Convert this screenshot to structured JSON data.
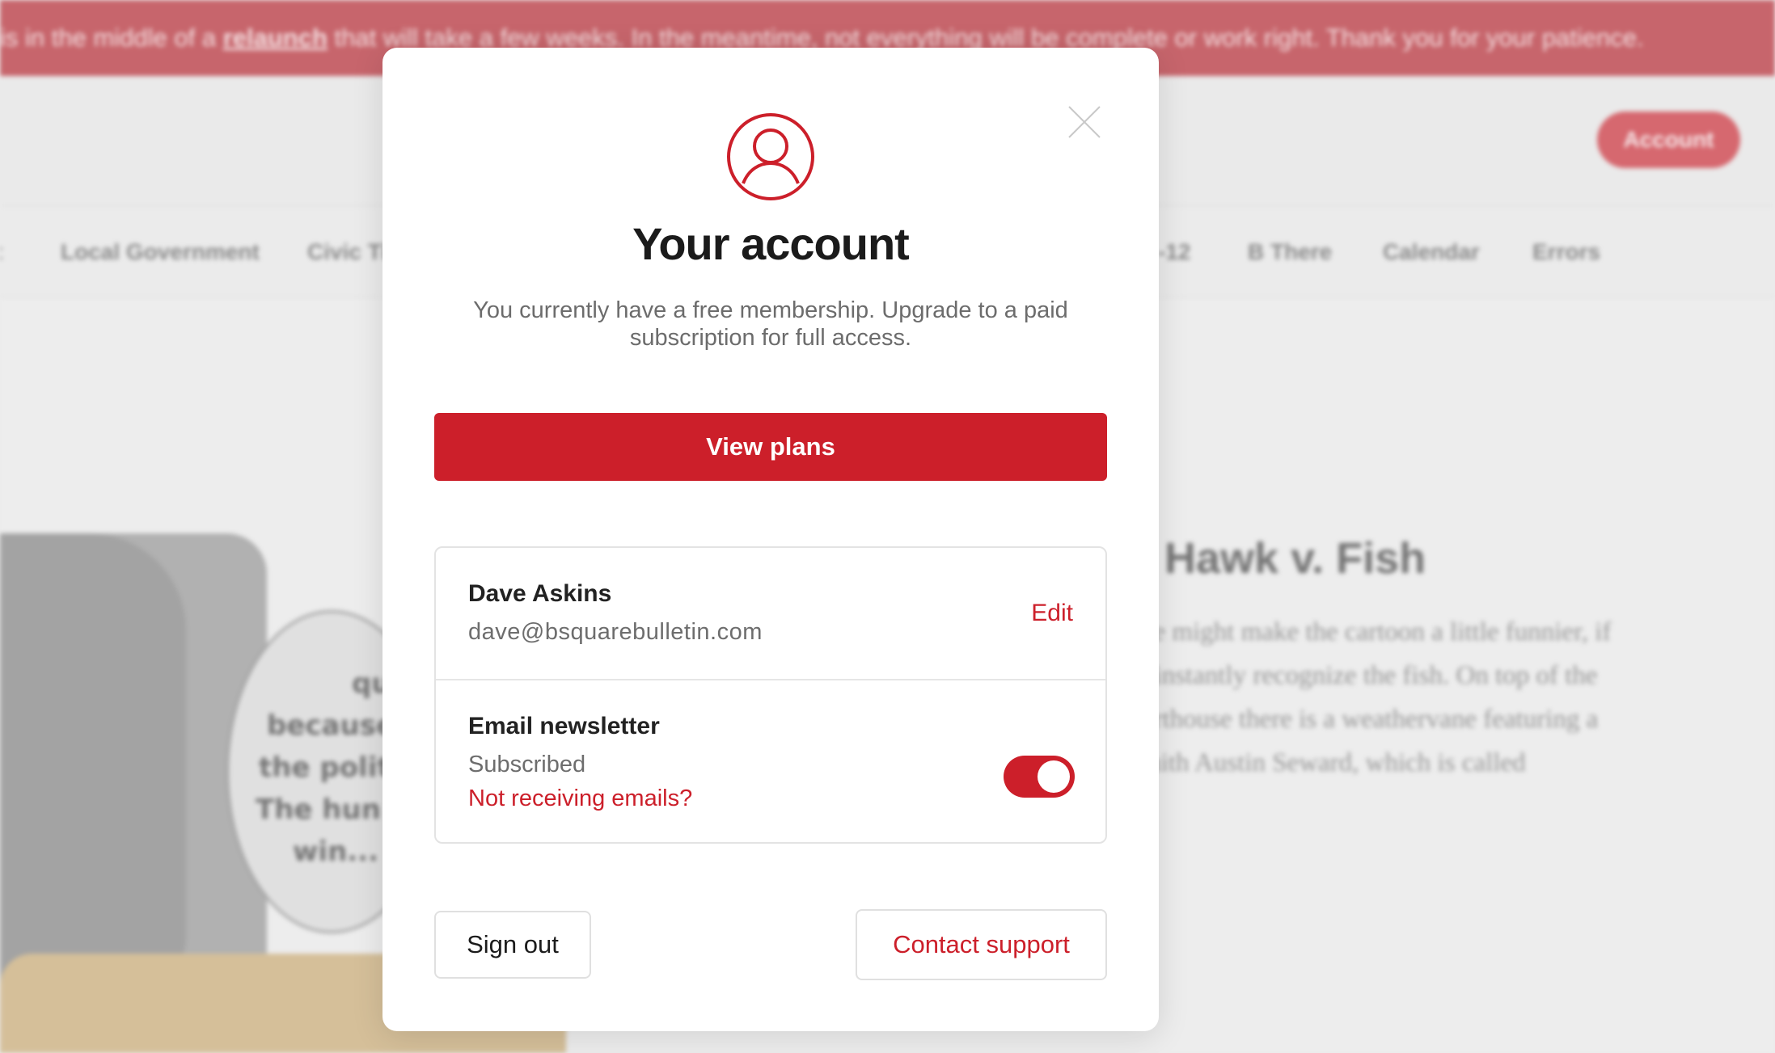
{
  "banner": {
    "text_before": "is in the middle of a ",
    "link": "relaunch",
    "text_after": " that will take a few weeks. In the meantime, not everything will be complete or work right. Thank you for your patience."
  },
  "header": {
    "account_label": "Account"
  },
  "nav": {
    "items": [
      "t",
      "Local Government",
      "Civic Ti",
      "-12",
      "B There",
      "Calendar",
      "Errors"
    ]
  },
  "article": {
    "title": "Hawk v. Fish",
    "lines": [
      "ge might make the cartoon a little funnier, if",
      "t instantly recognize the fish. On top of the",
      "urthouse there is a weathervane featuring a",
      "mith Austin Seward, which is called"
    ]
  },
  "cartoon": {
    "bubble_lines": [
      "qu",
      "because",
      "the polit",
      "The hun",
      "win... I"
    ]
  },
  "modal": {
    "title": "Your account",
    "subtitle": "You currently have a free membership. Upgrade to a paid subscription for full access.",
    "plans_label": "View plans",
    "profile": {
      "name": "Dave Askins",
      "email": "dave@bsquarebulletin.com",
      "edit_label": "Edit"
    },
    "newsletter": {
      "title": "Email newsletter",
      "status": "Subscribed",
      "help_link": "Not receiving emails?",
      "enabled": true
    },
    "signout_label": "Sign out",
    "support_label": "Contact support"
  },
  "colors": {
    "accent": "#cc1f2a",
    "banner": "#b11b25"
  },
  "icons": {
    "close": "close-icon",
    "avatar": "user-circle-icon"
  }
}
